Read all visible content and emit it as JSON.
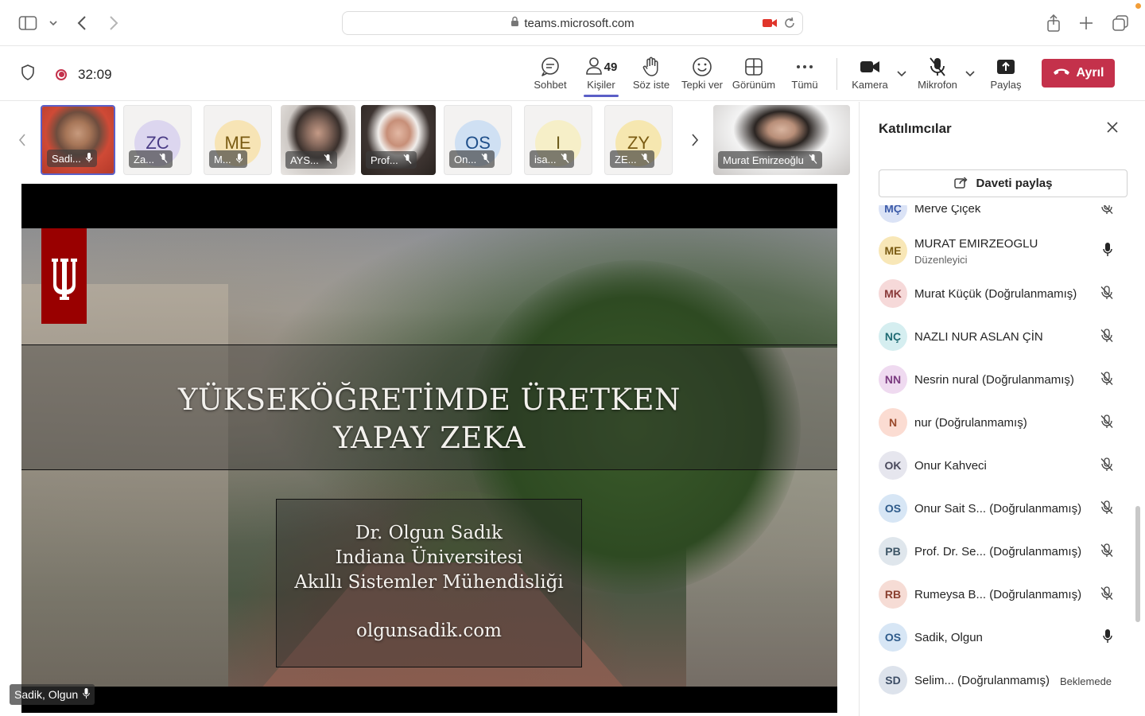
{
  "browser": {
    "url": "teams.microsoft.com"
  },
  "toolbar": {
    "timer": "32:09",
    "chat_label": "Sohbet",
    "people_label": "Kişiler",
    "people_count": "49",
    "raise_hand_label": "Söz iste",
    "react_label": "Tepki ver",
    "view_label": "Görünüm",
    "more_label": "Tümü",
    "camera_label": "Kamera",
    "mic_label": "Mikrofon",
    "share_label": "Paylaş",
    "leave_label": "Ayrıl"
  },
  "strip": {
    "tiles": [
      {
        "name": "Sadi...",
        "initials": "",
        "color": "#c9a98f"
      },
      {
        "name": "Za...",
        "initials": "ZC",
        "color": "#dcd6ef"
      },
      {
        "name": "M...",
        "initials": "ME",
        "color": "#f7e4b5"
      },
      {
        "name": "AYS...",
        "initials": "",
        "color": "#8c8480"
      },
      {
        "name": "Prof...",
        "initials": "",
        "color": "#6b5a55"
      },
      {
        "name": "On...",
        "initials": "OS",
        "color": "#cfe0f3"
      },
      {
        "name": "isa...",
        "initials": "I",
        "color": "#f6efc8"
      },
      {
        "name": "ZE...",
        "initials": "ZY",
        "color": "#f6e7b0"
      }
    ],
    "featured_name": "Murat Emirzeoğlu"
  },
  "slide": {
    "title_line1": "YÜKSEKÖĞRETİMDE ÜRETKEN",
    "title_line2": "YAPAY ZEKA",
    "presenter": "Dr. Olgun Sadık",
    "university": "Indiana Üniversitesi",
    "department": "Akıllı Sistemler Mühendisliği",
    "website": "olgunsadik.com"
  },
  "stage": {
    "speaker_name": "Sadik, Olgun"
  },
  "panel": {
    "title": "Katılımcılar",
    "invite_label": "Daveti paylaş",
    "participants": [
      {
        "initials": "MÇ",
        "name": "Merve Çiçek",
        "role": "",
        "status": "",
        "mic": "muted",
        "bg": "#dbe3f6",
        "fg": "#3b5aa8"
      },
      {
        "initials": "ME",
        "name": "MURAT EMIRZEOGLU",
        "role": "Düzenleyici",
        "status": "",
        "mic": "on",
        "bg": "#f8e7b7",
        "fg": "#7a5b12"
      },
      {
        "initials": "MK",
        "name": "Murat Küçük (Doğrulanmamış)",
        "role": "",
        "status": "",
        "mic": "muted",
        "bg": "#f6d9d9",
        "fg": "#8a3a3a"
      },
      {
        "initials": "NÇ",
        "name": "NAZLI NUR ASLAN ÇİN",
        "role": "",
        "status": "",
        "mic": "muted",
        "bg": "#d5eef0",
        "fg": "#1f6b73"
      },
      {
        "initials": "NN",
        "name": "Nesrin nural (Doğrulanmamış)",
        "role": "",
        "status": "",
        "mic": "muted",
        "bg": "#efdaf0",
        "fg": "#7b3a80"
      },
      {
        "initials": "N",
        "name": "nur (Doğrulanmamış)",
        "role": "",
        "status": "",
        "mic": "muted",
        "bg": "#fbdcd2",
        "fg": "#9a4a2c"
      },
      {
        "initials": "OK",
        "name": "Onur Kahveci",
        "role": "",
        "status": "",
        "mic": "muted",
        "bg": "#e6e6ee",
        "fg": "#4a4a5c"
      },
      {
        "initials": "OS",
        "name": "Onur Sait S... (Doğrulanmamış)",
        "role": "",
        "status": "",
        "mic": "muted",
        "bg": "#d7e6f5",
        "fg": "#2d5a8a"
      },
      {
        "initials": "PB",
        "name": "Prof. Dr. Se... (Doğrulanmamış)",
        "role": "",
        "status": "",
        "mic": "muted",
        "bg": "#dfe6ec",
        "fg": "#3d5566"
      },
      {
        "initials": "RB",
        "name": "Rumeysa B... (Doğrulanmamış)",
        "role": "",
        "status": "",
        "mic": "muted",
        "bg": "#f6dcd5",
        "fg": "#8a4030"
      },
      {
        "initials": "OS",
        "name": "Sadik, Olgun",
        "role": "",
        "status": "",
        "mic": "on",
        "bg": "#d7e6f5",
        "fg": "#2d5a8a"
      },
      {
        "initials": "SD",
        "name": "Selim... (Doğrulanmamış)",
        "role": "",
        "status": "Beklemede",
        "mic": "none",
        "bg": "#dde3ec",
        "fg": "#3d4e66"
      }
    ]
  }
}
